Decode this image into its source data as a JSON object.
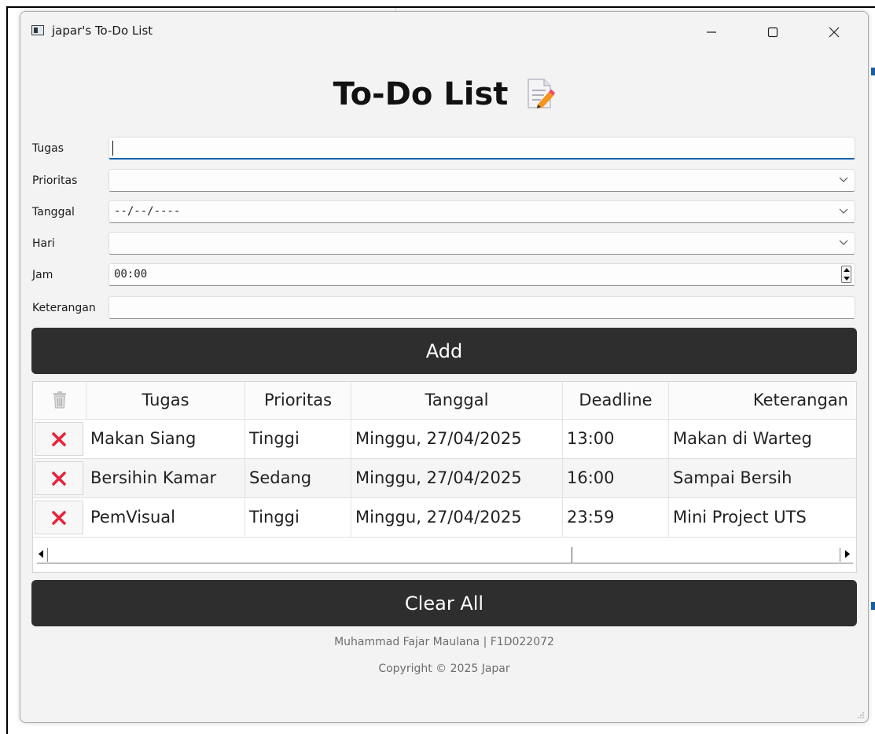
{
  "window": {
    "title": "japar's To-Do List",
    "controls": [
      "minimize",
      "maximize",
      "close"
    ]
  },
  "heading": {
    "text": "To-Do List",
    "icon": "memo-icon"
  },
  "form": {
    "tugas": {
      "label": "Tugas",
      "value": ""
    },
    "prioritas": {
      "label": "Prioritas",
      "value": ""
    },
    "tanggal": {
      "label": "Tanggal",
      "value": "--/--/----"
    },
    "hari": {
      "label": "Hari",
      "value": ""
    },
    "jam": {
      "label": "Jam",
      "value": "00:00"
    },
    "keterangan": {
      "label": "Keterangan",
      "value": ""
    }
  },
  "buttons": {
    "add": "Add",
    "clear_all": "Clear All"
  },
  "table": {
    "headers": [
      "Tugas",
      "Prioritas",
      "Tanggal",
      "Deadline",
      "Keterangan"
    ],
    "rows": [
      {
        "tugas": "Makan Siang",
        "prioritas": "Tinggi",
        "tanggal": "Minggu, 27/04/2025",
        "deadline": "13:00",
        "keterangan": "Makan di Warteg"
      },
      {
        "tugas": "Bersihin Kamar",
        "prioritas": "Sedang",
        "tanggal": "Minggu, 27/04/2025",
        "deadline": "16:00",
        "keterangan": "Sampai Bersih"
      },
      {
        "tugas": "PemVisual",
        "prioritas": "Tinggi",
        "tanggal": "Minggu, 27/04/2025",
        "deadline": "23:59",
        "keterangan": "Mini Project UTS"
      }
    ]
  },
  "footer": {
    "author": "Muhammad Fajar Maulana | F1D022072",
    "copyright": "Copyright © 2025 Japar"
  },
  "colors": {
    "button_bg": "#2e2e2e",
    "delete_x": "#e8213a",
    "focus_underline": "#1c64b3"
  }
}
